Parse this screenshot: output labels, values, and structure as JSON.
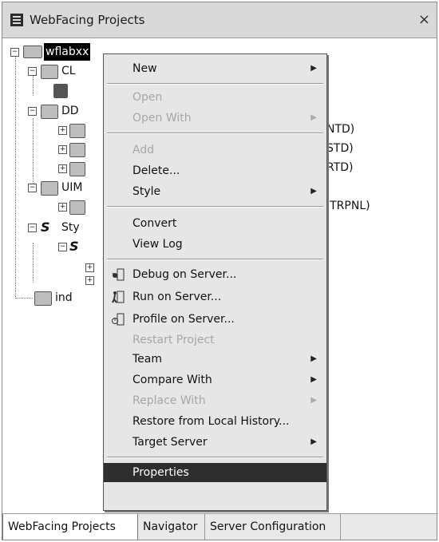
{
  "window": {
    "title": "WebFacing Projects",
    "close": "×"
  },
  "tree": {
    "root": "wflabxx",
    "nodes": [
      {
        "label": "CL"
      },
      {
        "label": "DD"
      },
      {
        "label": "NTD)"
      },
      {
        "label": "STD)"
      },
      {
        "label": "RTD)"
      },
      {
        "label": "UIM"
      },
      {
        "label": "ITRPNL)"
      },
      {
        "label": "Sty"
      },
      {
        "label": "ind"
      }
    ]
  },
  "menu": {
    "items": [
      {
        "label": "New",
        "enabled": true,
        "submenu": true
      },
      {
        "label": "Open",
        "enabled": false,
        "submenu": false
      },
      {
        "label": "Open With",
        "enabled": false,
        "submenu": true
      },
      {
        "label": "Add",
        "enabled": false,
        "submenu": false
      },
      {
        "label": "Delete...",
        "enabled": true,
        "submenu": false
      },
      {
        "label": "Style",
        "enabled": true,
        "submenu": true
      },
      {
        "label": "Convert",
        "enabled": true,
        "submenu": false
      },
      {
        "label": "View Log",
        "enabled": true,
        "submenu": false
      },
      {
        "label": "Debug on Server...",
        "enabled": true,
        "submenu": false,
        "icon": "debug-server-icon"
      },
      {
        "label": "Run on Server...",
        "enabled": true,
        "submenu": false,
        "icon": "run-server-icon"
      },
      {
        "label": "Profile on Server...",
        "enabled": true,
        "submenu": false,
        "icon": "profile-server-icon"
      },
      {
        "label": "Restart Project",
        "enabled": false,
        "submenu": false
      },
      {
        "label": "Team",
        "enabled": true,
        "submenu": true
      },
      {
        "label": "Compare With",
        "enabled": true,
        "submenu": true
      },
      {
        "label": "Replace With",
        "enabled": false,
        "submenu": true
      },
      {
        "label": "Restore from Local History...",
        "enabled": true,
        "submenu": false
      },
      {
        "label": "Target Server",
        "enabled": true,
        "submenu": true
      },
      {
        "label": "Properties",
        "enabled": true,
        "submenu": false,
        "highlighted": true
      }
    ],
    "submenu_arrow": "▶"
  },
  "tabs": [
    "WebFacing Projects",
    "Navigator",
    "Server Configuration"
  ],
  "colors": {
    "highlight": "#2e2e2e",
    "menu_bg": "#e6e6e6",
    "disabled_text": "#a6a6a6"
  }
}
